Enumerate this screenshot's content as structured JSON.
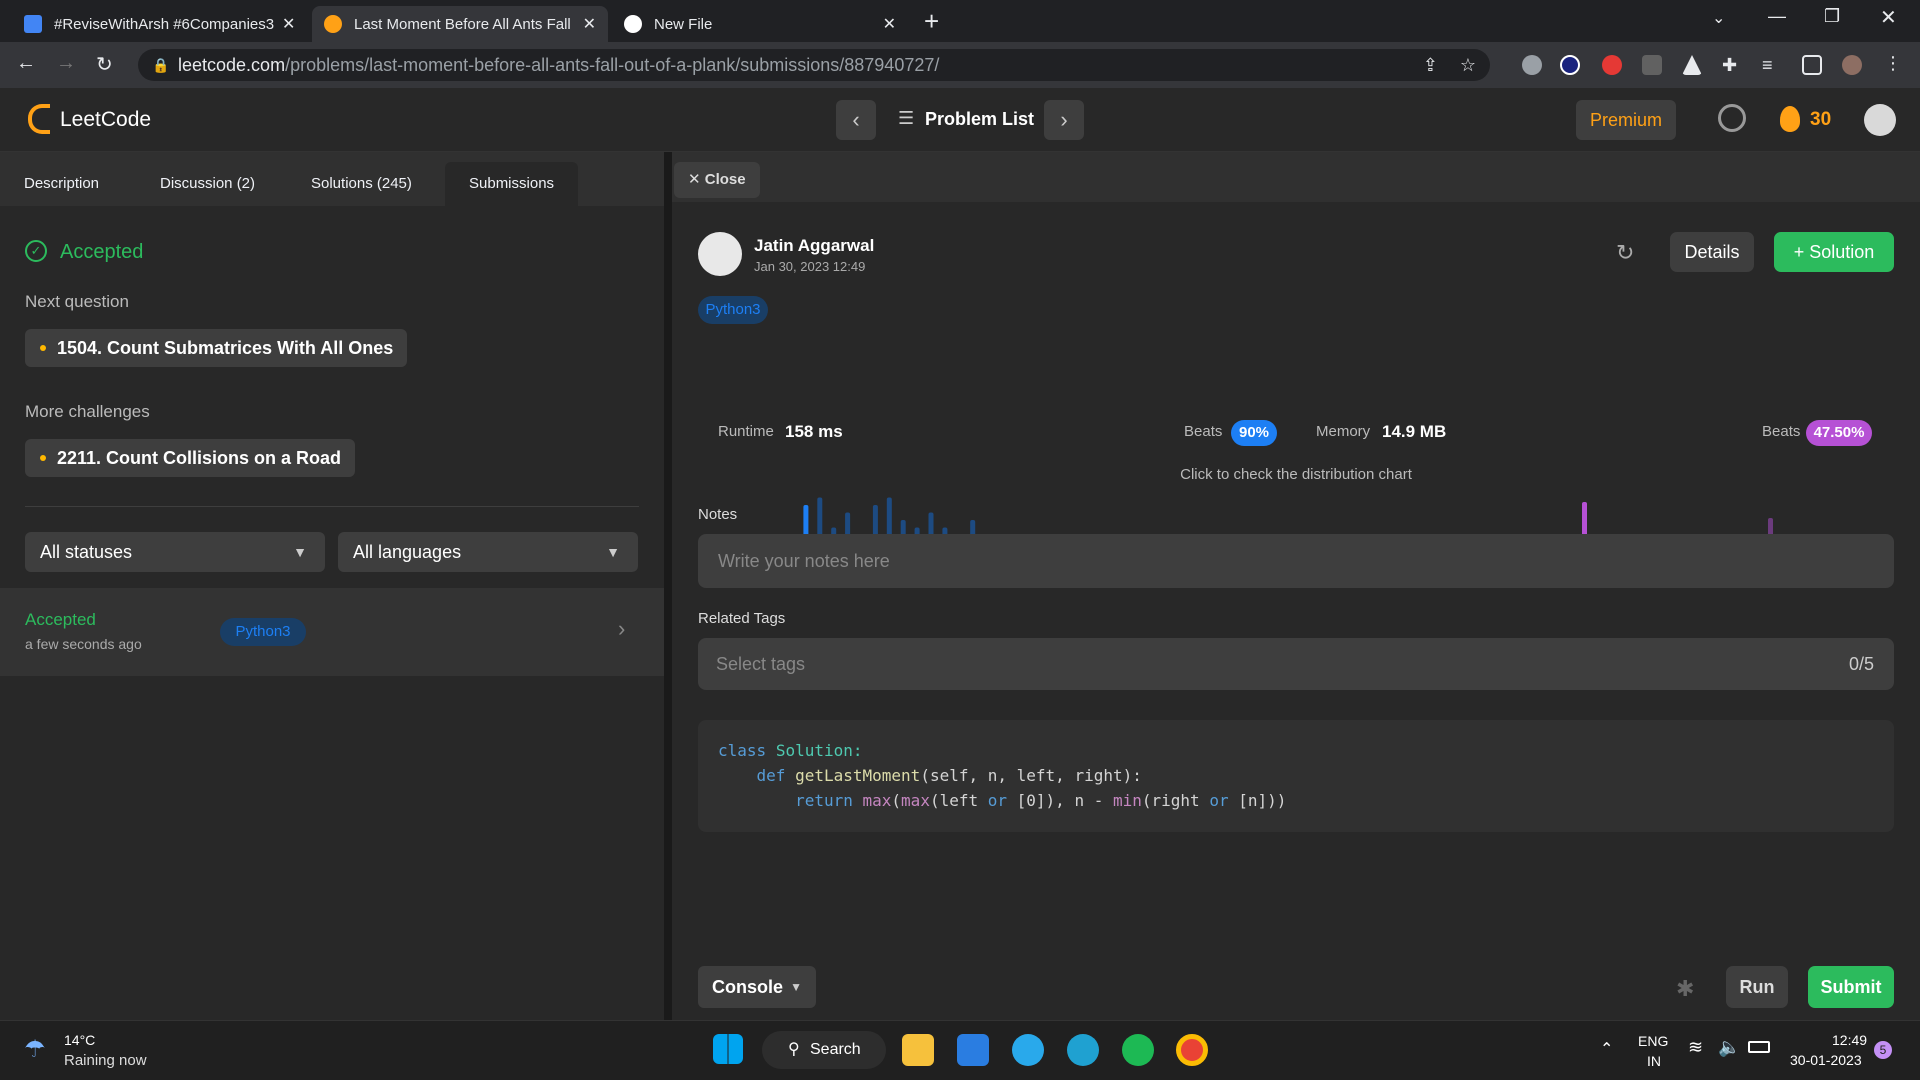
{
  "browser": {
    "tabs": [
      {
        "title": "#ReviseWithArsh #6Companies3",
        "favicon_color": "#4285f4"
      },
      {
        "title": "Last Moment Before All Ants Fall",
        "favicon_color": "#ffa116"
      },
      {
        "title": "New File",
        "favicon_color": "#ffffff"
      }
    ],
    "new_tab_label": "+",
    "url_host": "leetcode.com",
    "url_path": "/problems/last-moment-before-all-ants-fall-out-of-a-plank/submissions/887940727/"
  },
  "header": {
    "logo": "LeetCode",
    "problem_list": "Problem List",
    "premium": "Premium",
    "streak": "30"
  },
  "left": {
    "tabs": [
      "Description",
      "Discussion (2)",
      "Solutions (245)",
      "Submissions"
    ],
    "status": "Accepted",
    "next_question_label": "Next question",
    "next_question": "1504. Count Submatrices With All Ones",
    "more_challenges_label": "More challenges",
    "more_challenge": "2211. Count Collisions on a Road",
    "status_filter": "All statuses",
    "language_filter": "All languages",
    "submission": {
      "status": "Accepted",
      "time": "a few seconds ago",
      "language": "Python3"
    }
  },
  "right": {
    "close_label": "Close",
    "user_name": "Jatin Aggarwal",
    "date": "Jan 30, 2023 12:49",
    "details_label": "Details",
    "solution_label": "+ Solution",
    "language": "Python3",
    "runtime_label": "Runtime",
    "runtime_value": "158 ms",
    "runtime_beats_label": "Beats",
    "runtime_beats": "90%",
    "memory_label": "Memory",
    "memory_value": "14.9 MB",
    "memory_beats_label": "Beats",
    "memory_beats": "47.50%",
    "distribution_hint": "Click to check the distribution chart",
    "notes_label": "Notes",
    "notes_placeholder": "Write your notes here",
    "tags_label": "Related Tags",
    "tags_placeholder": "Select tags",
    "tags_count": "0/5",
    "code_line1_kw": "class",
    "code_line1_name": "Solution:",
    "code_line2_kw": "def",
    "code_line2_fn": "getLastMoment",
    "code_line2_rest": "(self, n, left, right):",
    "code_line3_kw": "return",
    "code_line3_max1": "max",
    "code_line3_p1": "(",
    "code_line3_max2": "max",
    "code_line3_p2": "(left ",
    "code_line3_or1": "or",
    "code_line3_p3": " [0]), n - ",
    "code_line3_min": "min",
    "code_line3_p4": "(right ",
    "code_line3_or2": "or",
    "code_line3_p5": " [n]))",
    "console_label": "Console",
    "run_label": "Run",
    "submit_label": "Submit"
  },
  "chart_data": {
    "type": "bar",
    "series": [
      {
        "name": "Runtime",
        "values": [
          1,
          1,
          1,
          2,
          1,
          2,
          6,
          7,
          3,
          5,
          2,
          6,
          7,
          4,
          3,
          5,
          3,
          2,
          4,
          2,
          1,
          1,
          1,
          1,
          1,
          1,
          1,
          1,
          1,
          1,
          1,
          1,
          1,
          1,
          1,
          1,
          1,
          1,
          1,
          1
        ],
        "highlight_index": 6,
        "color": "#1d7ff4"
      },
      {
        "name": "Memory",
        "values": [
          0.3,
          6,
          4
        ],
        "color": "#b651d5"
      }
    ]
  },
  "taskbar": {
    "weather_temp": "14°C",
    "weather_desc": "Raining now",
    "search_label": "Search",
    "lang1": "ENG",
    "lang2": "IN",
    "time": "12:49",
    "date": "30-01-2023",
    "notif_count": "5"
  }
}
